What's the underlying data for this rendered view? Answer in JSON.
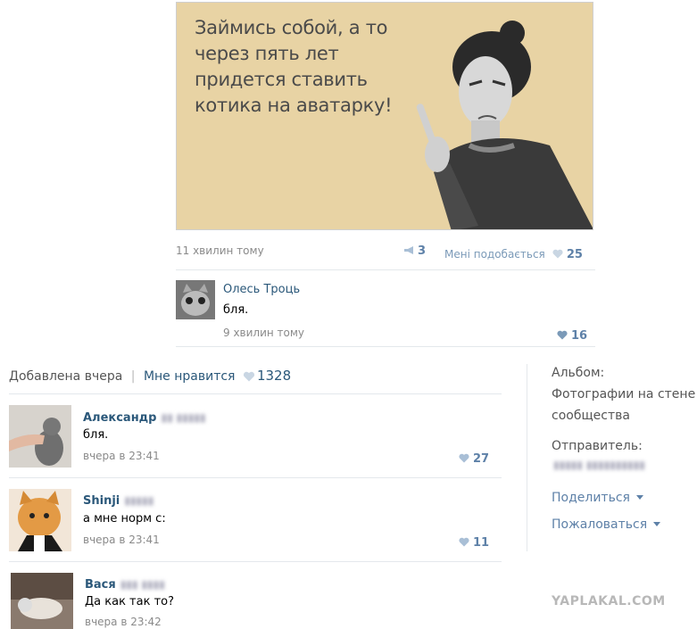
{
  "meme": {
    "lines": [
      "Займись собой, а то",
      "через пять лет",
      "придется ставить",
      "котика на аватарку!"
    ]
  },
  "post": {
    "time": "11 хвилин тому",
    "reposts": "3",
    "like_label": "Мені подобається",
    "likes": "25"
  },
  "top_comment": {
    "author": "Олесь Троць",
    "text": "бля.",
    "time": "9 хвилин тому",
    "likes": "16"
  },
  "photo_meta": {
    "added": "Добавлена вчера",
    "divider": "|",
    "like_label": "Мне нравится",
    "likes": "1328"
  },
  "comments": [
    {
      "author": "Александр",
      "text": "бля.",
      "time": "вчера в 23:41",
      "likes": "27"
    },
    {
      "author": "Shinji",
      "text": "а мне норм с:",
      "time": "вчера в 23:41",
      "likes": "11"
    },
    {
      "author": "Вася",
      "text": "Да как так то?",
      "time": "вчера в 23:42",
      "likes": ""
    }
  ],
  "sidebar": {
    "album_label": "Альбом:",
    "album_line1": "Фотографии на стене",
    "album_line2": "сообщества",
    "sender_label": "Отправитель:",
    "share": "Поделиться",
    "report": "Пожаловаться"
  },
  "watermark": "YAPLAKAL.COM",
  "colors": {
    "link": "#2b587a",
    "heart": "#a9bfd6",
    "meme_bg": "#e8d3a4"
  }
}
